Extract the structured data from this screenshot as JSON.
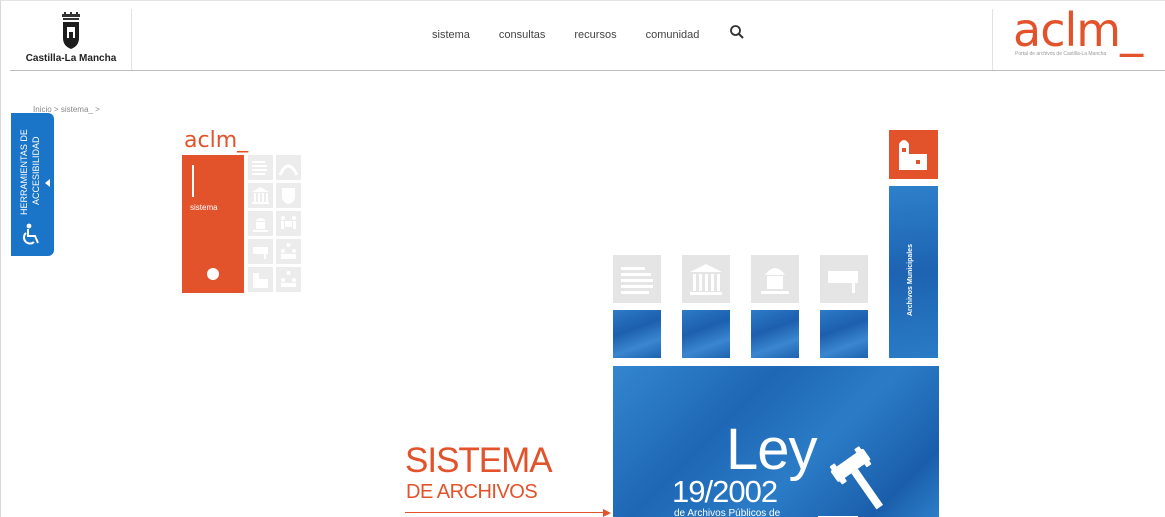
{
  "header": {
    "jccm_name": "Castilla-La Mancha",
    "nav": [
      {
        "label": "sistema"
      },
      {
        "label": "consultas"
      },
      {
        "label": "recursos"
      },
      {
        "label": "comunidad"
      }
    ],
    "search_icon": "search-icon",
    "brand_logo": "aclm_",
    "brand_subtitle": "Portal de archivos de Castilla-La Mancha"
  },
  "breadcrumb": {
    "home": "Inicio",
    "sep": ">",
    "current": "sistema_",
    "sep2": ">"
  },
  "accessibility": {
    "line1": "HERRAMIENTAS DE",
    "line2": "ACCESIBILIDAD",
    "icon": "accessibility-icon"
  },
  "mini_menu": {
    "logo": "aclm_",
    "active_label": "sistema"
  },
  "diagram": {
    "title": "SISTEMA",
    "subtitle": "DE ARCHIVOS",
    "ley_word": "Ley",
    "ley_number": "19/2002",
    "ley_desc": "de Archivos Públicos de",
    "municipal_label": "Archivos Municipales"
  },
  "colors": {
    "accent": "#e2532c",
    "blue": "#1a74c7",
    "tile_gray": "#e5e5e5"
  }
}
